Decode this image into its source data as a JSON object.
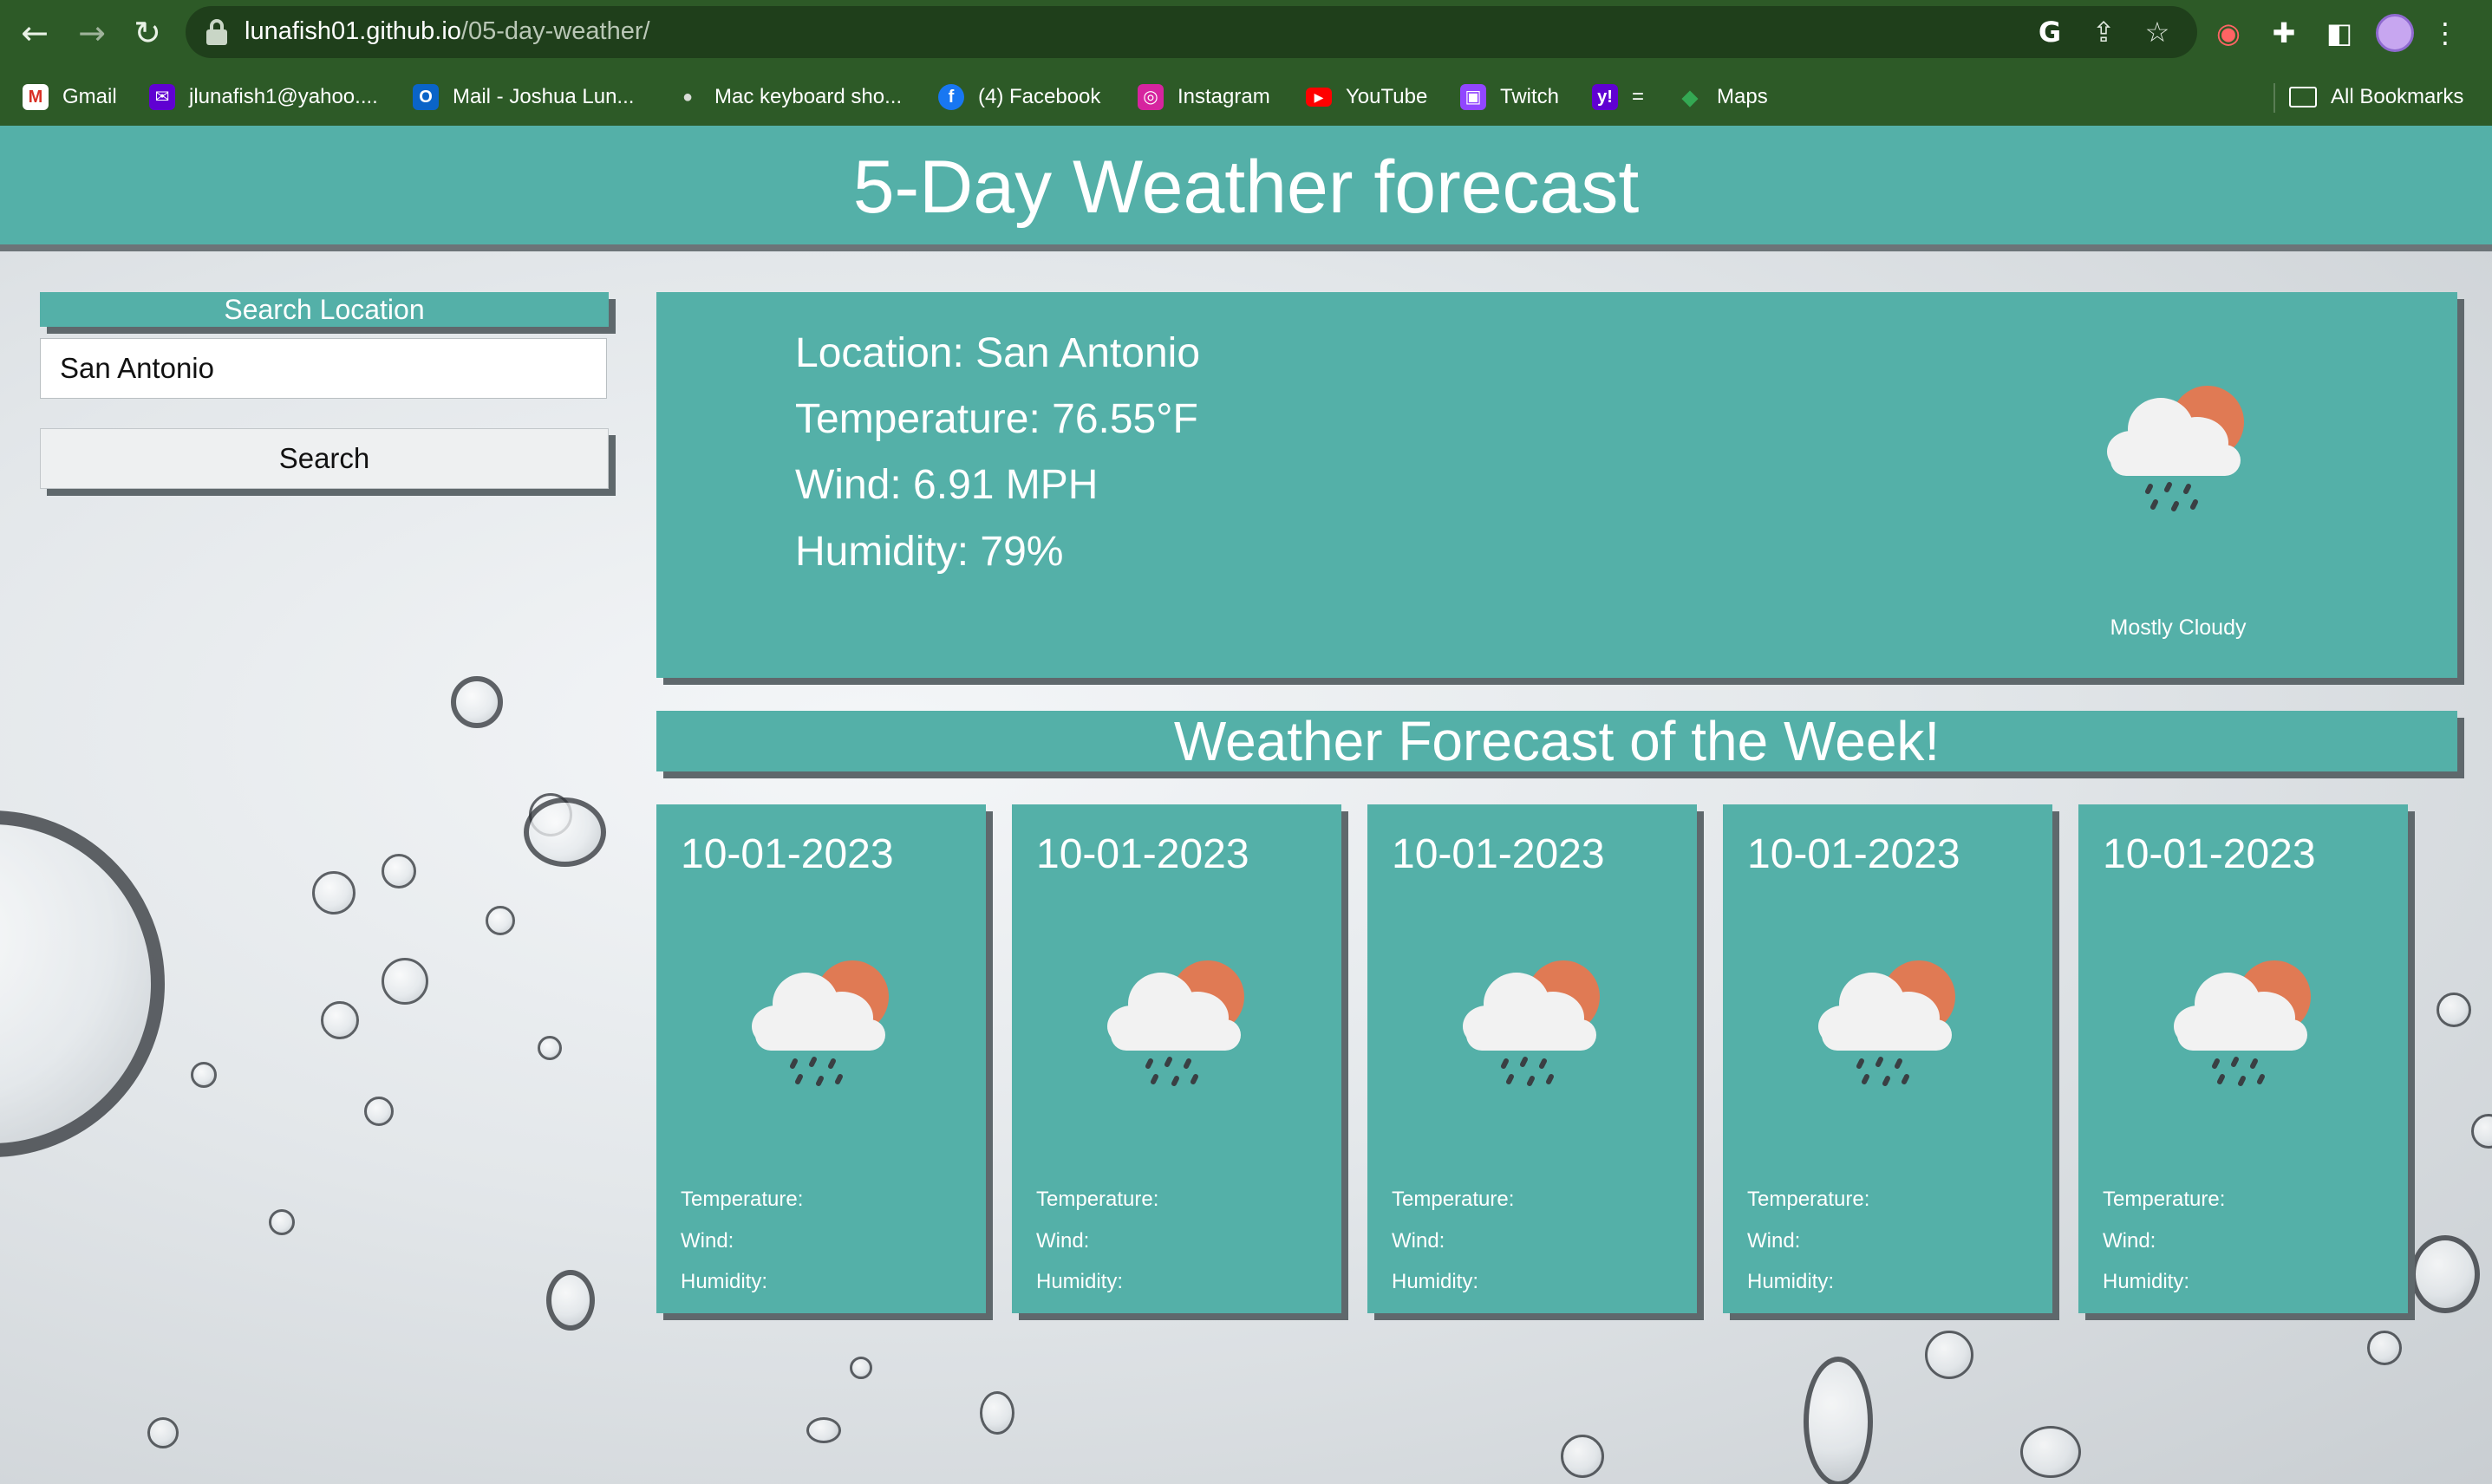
{
  "browser": {
    "url_host": "lunafish01.github.io",
    "url_path": "/05-day-weather/",
    "bookmarks": [
      {
        "label": "Gmail",
        "icon": "gmail-icon"
      },
      {
        "label": "jlunafish1@yahoo....",
        "icon": "mail-icon"
      },
      {
        "label": "Mail - Joshua Lun...",
        "icon": "outlook-icon"
      },
      {
        "label": "Mac keyboard sho...",
        "icon": "apple-icon"
      },
      {
        "label": "(4) Facebook",
        "icon": "facebook-icon"
      },
      {
        "label": "Instagram",
        "icon": "instagram-icon"
      },
      {
        "label": "YouTube",
        "icon": "youtube-icon"
      },
      {
        "label": "Twitch",
        "icon": "twitch-icon"
      },
      {
        "label": "=",
        "icon": "yahoo-icon"
      },
      {
        "label": "Maps",
        "icon": "maps-icon"
      }
    ],
    "all_bookmarks_label": "All Bookmarks"
  },
  "header": {
    "title": "5-Day Weather forecast"
  },
  "search": {
    "title": "Search Location",
    "input_value": "San Antonio",
    "button_label": "Search"
  },
  "current": {
    "location": "Location: San Antonio",
    "temperature": "Temperature: 76.55°F",
    "wind": "Wind: 6.91 MPH",
    "humidity": "Humidity: 79%",
    "description": "Mostly Cloudy",
    "icon": "cloud-sun-rain-icon"
  },
  "forecast": {
    "title": "Weather Forecast of the Week!",
    "days": [
      {
        "date": "10-01-2023",
        "temperature": "Temperature:",
        "wind": "Wind:",
        "humidity": "Humidity:"
      },
      {
        "date": "10-01-2023",
        "temperature": "Temperature:",
        "wind": "Wind:",
        "humidity": "Humidity:"
      },
      {
        "date": "10-01-2023",
        "temperature": "Temperature:",
        "wind": "Wind:",
        "humidity": "Humidity:"
      },
      {
        "date": "10-01-2023",
        "temperature": "Temperature:",
        "wind": "Wind:",
        "humidity": "Humidity:"
      },
      {
        "date": "10-01-2023",
        "temperature": "Temperature:",
        "wind": "Wind:",
        "humidity": "Humidity:"
      }
    ]
  },
  "colors": {
    "chrome": "#2d5a27",
    "teal": "#54b0a8",
    "cloud": "#f2f2f2",
    "sun": "#e07a54",
    "rain": "#3a3f43"
  }
}
